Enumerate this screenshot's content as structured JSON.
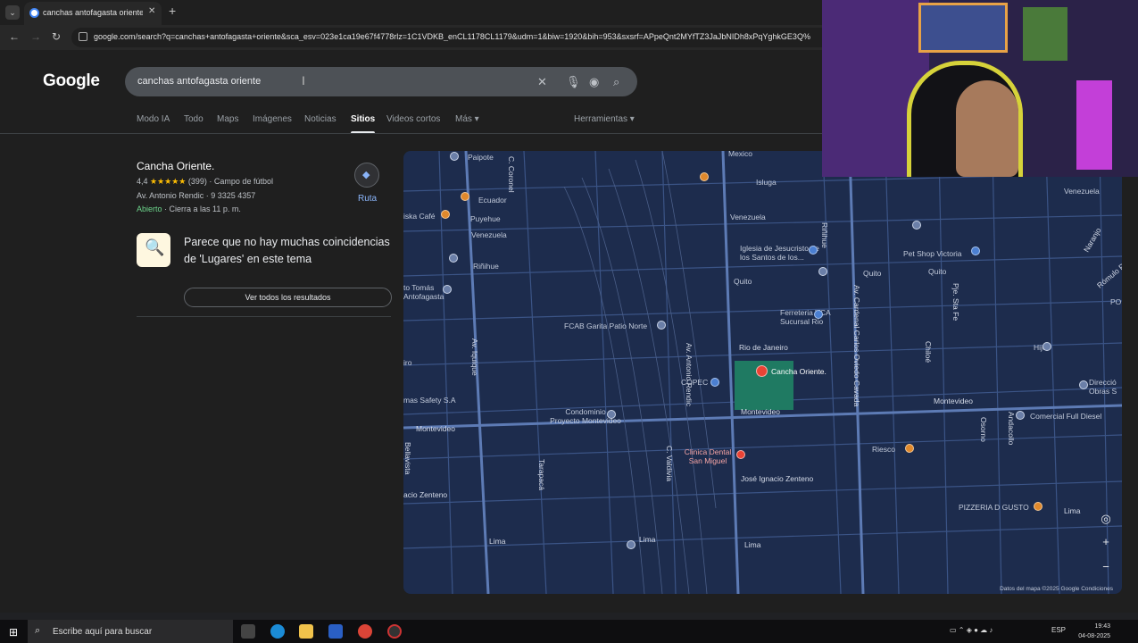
{
  "browser": {
    "tab_title": "canchas antofagasta oriente - B",
    "url": "google.com/search?q=canchas+antofagasta+oriente&sca_esv=023e1ca19e67f4778rlz=1C1VDKB_enCL1178CL1179&udm=1&biw=1920&bih=953&sxsrf=APpeQnt2MYfTZ3JaJbNIDh8xPqYghkGE3Q%"
  },
  "google": {
    "logo": "Google",
    "query": "canchas antofagasta oriente",
    "tabs": [
      "Modo IA",
      "Todo",
      "Maps",
      "Imágenes",
      "Noticias",
      "Sitios",
      "Videos cortos",
      "Más ▾"
    ],
    "active_tab": "Sitios",
    "tools": "Herramientas ▾"
  },
  "result": {
    "title": "Cancha Oriente.",
    "rating": "4,4",
    "stars": "★★★★★",
    "reviews": "(399)",
    "category": "· Campo de fútbol",
    "address": "Av. Antonio Rendic · 9 3325 4357",
    "status": "Abierto",
    "hours": " · Cierra a las 11 p. m.",
    "route_label": "Ruta"
  },
  "no_match": {
    "message": "Parece que no hay muchas coincidencias de 'Lugares' en este tema",
    "button": "Ver todos los resultados"
  },
  "map": {
    "labels": {
      "mexico": "Mexico",
      "paipote": "Paipote",
      "coronel": "C. Coronel",
      "isluga": "Isluga",
      "ecuador": "Ecuador",
      "iska_cafe": "iska Café",
      "puyehue": "Puyehue",
      "venezuela1": "Venezuela",
      "venezuela2": "Venezuela",
      "venezuela3": "Venezuela",
      "iglesia": "Iglesia de Jesucristo de los Santos de los...",
      "pet_shop": "Pet Shop Victoria",
      "quito1": "Quito",
      "quito2": "Quito",
      "quito3": "Quito",
      "rinihue": "Riñihue",
      "to_tomas": "to Tomás Antofagasta",
      "ferreteria": "Ferreteria VCA Sucursal Rio",
      "fcab": "FCAB Garita Patio Norte",
      "rio_janeiro": "Rio de Janeiro",
      "cancha": "Cancha Oriente.",
      "copec": "COPEC",
      "montevideo1": "Montevideo",
      "montevideo2": "Montevideo",
      "montevideo3": "Montevideo",
      "comercial": "Comercial Full Diesel",
      "condominio": "Condominio Proyecto Montevideo",
      "clinica": "Clinica Dental San Miguel",
      "riesco": "Riesco",
      "jose_ignacio": "José Ignacio Zenteno",
      "zenteno_left": "acio Zenteno",
      "pizzeria": "PIZZERIA D GUSTO",
      "lima1": "Lima",
      "lima2": "Lima",
      "lima3": "Lima",
      "lima4": "Lima",
      "mas_safety": "mas Safety S.A",
      "hijo": "Hijo",
      "direccion": "Direcció Obras S",
      "po": "PO",
      "rio_left": "iro",
      "av_rendic": "Av. Antonio Rendic",
      "av_iquique": "Av. Iquique",
      "av_cardenal": "Av. Cardenal Carlos Oviedo Cavada",
      "chiloe": "Chiloé",
      "valdivia": "C. Valdivia",
      "tarapaca": "Tarapacá",
      "bellavista": "Bellavista",
      "osorno": "Osorno",
      "andacollo": "Andacollo",
      "pje_sta_fe": "Pje. Sta Fe",
      "naranjo": "Naranjo",
      "romulo": "Rómulo Per",
      "rinihue_v": "Riñihue"
    },
    "footer": "Datos del mapa ©2025 Google   Condiciones",
    "zoom_in": "+",
    "zoom_out": "−"
  },
  "taskbar": {
    "search_placeholder": "Escribe aquí para buscar",
    "lang": "ESP",
    "time": "19:43",
    "date": "04-08-2025"
  },
  "colors": {
    "map_bg": "#1d2c4d",
    "field": "#1f7a62",
    "accent_blue": "#8ab4f8"
  }
}
